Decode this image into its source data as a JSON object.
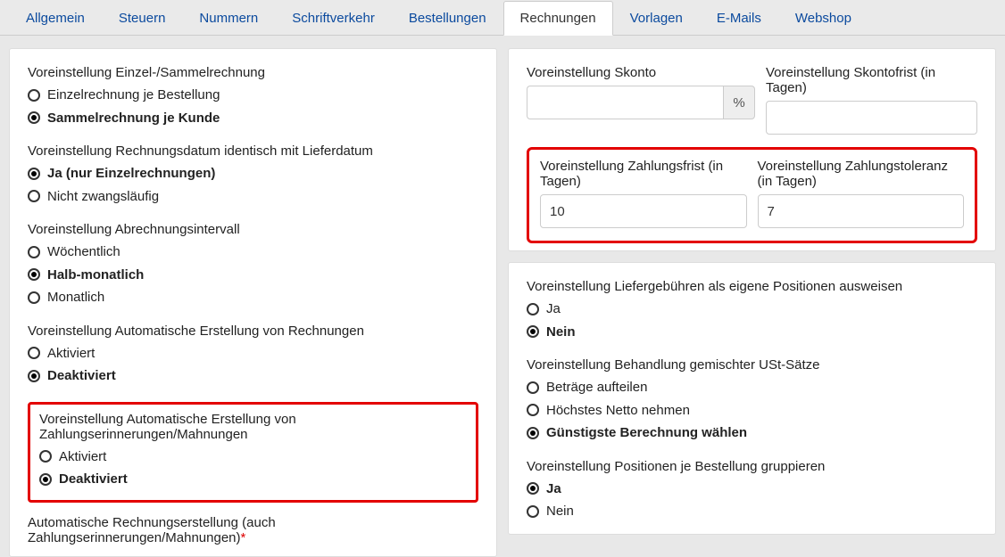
{
  "tabs": {
    "t0": "Allgemein",
    "t1": "Steuern",
    "t2": "Nummern",
    "t3": "Schriftverkehr",
    "t4": "Bestellungen",
    "t5": "Rechnungen",
    "t6": "Vorlagen",
    "t7": "E-Mails",
    "t8": "Webshop"
  },
  "left": {
    "g1": {
      "title": "Voreinstellung Einzel-/Sammelrechnung",
      "o1": "Einzelrechnung je Bestellung",
      "o2": "Sammelrechnung je Kunde"
    },
    "g2": {
      "title": "Voreinstellung Rechnungsdatum identisch mit Lieferdatum",
      "o1": "Ja (nur Einzelrechnungen)",
      "o2": "Nicht zwangsläufig"
    },
    "g3": {
      "title": "Voreinstellung Abrechnungsintervall",
      "o1": "Wöchentlich",
      "o2": "Halb-monatlich",
      "o3": "Monatlich"
    },
    "g4": {
      "title": "Voreinstellung Automatische Erstellung von Rechnungen",
      "o1": "Aktiviert",
      "o2": "Deaktiviert"
    },
    "g5": {
      "title": "Voreinstellung Automatische Erstellung von Zahlungserinnerungen/Mahnungen",
      "o1": "Aktiviert",
      "o2": "Deaktiviert"
    },
    "g6": {
      "title": "Automatische Rechnungserstellung (auch Zahlungserinnerungen/Mahnungen)",
      "star": "*"
    }
  },
  "right": {
    "f1": {
      "label": "Voreinstellung Skonto",
      "unit": "%"
    },
    "f2": {
      "label": "Voreinstellung Skontofrist (in Tagen)"
    },
    "f3": {
      "label": "Voreinstellung Zahlungsfrist (in Tagen)",
      "value": "10"
    },
    "f4": {
      "label": "Voreinstellung Zahlungstoleranz (in Tagen)",
      "value": "7"
    },
    "g1": {
      "title": "Voreinstellung Liefergebühren als eigene Positionen ausweisen",
      "o1": "Ja",
      "o2": "Nein"
    },
    "g2": {
      "title": "Voreinstellung Behandlung gemischter USt-Sätze",
      "o1": "Beträge aufteilen",
      "o2": "Höchstes Netto nehmen",
      "o3": "Günstigste Berechnung wählen"
    },
    "g3": {
      "title": "Voreinstellung Positionen je Bestellung gruppieren",
      "o1": "Ja",
      "o2": "Nein"
    }
  }
}
